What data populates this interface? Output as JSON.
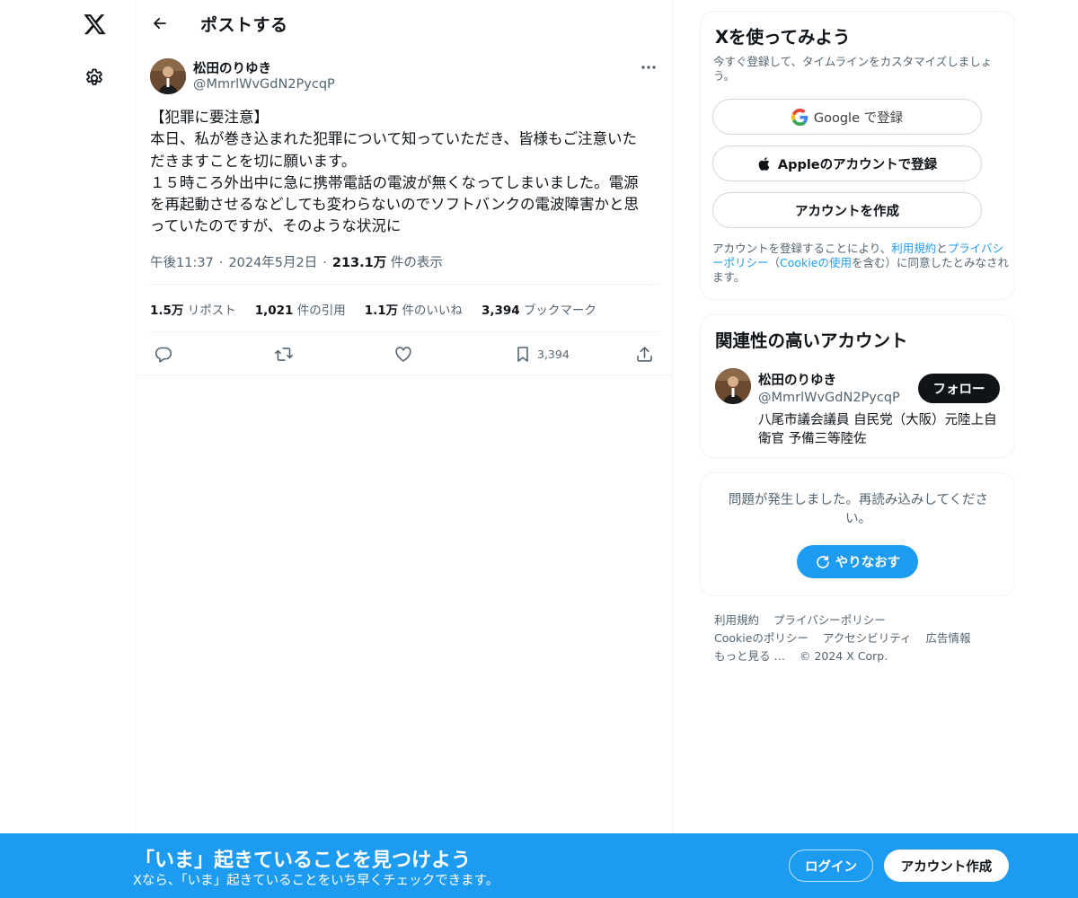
{
  "header": {
    "title": "ポストする"
  },
  "tweet": {
    "author": {
      "name": "松田のりゆき",
      "handle": "@MmrlWvGdN2PycqP"
    },
    "text_lines": [
      "【犯罪に要注意】",
      "本日、私が巻き込まれた犯罪について知っていただき、皆様もご注意いた",
      "だきますことを切に願います。",
      "１５時ころ外出中に急に携帯電話の電波が無くなってしまいました。電源",
      "を再起動させるなどしても変わらないのでソフトバンクの電波障害かと思",
      "っていたのですが、そのような状況に"
    ],
    "time": "午後11:37",
    "date": "2024年5月2日",
    "views_count": "213.1万",
    "views_label": "件の表示",
    "stats": {
      "reposts": {
        "value": "1.5万",
        "label": "リポスト"
      },
      "quotes": {
        "value": "1,021",
        "label": "件の引用"
      },
      "likes": {
        "value": "1.1万",
        "label": "件のいいね"
      },
      "bookmarks": {
        "value": "3,394",
        "label": "ブックマーク"
      }
    },
    "actions": {
      "bookmark_count": "3,394"
    }
  },
  "signup": {
    "title": "Xを使ってみよう",
    "subtitle": "今すぐ登録して、タイムラインをカスタマイズしましょう。",
    "google_label": "Google で登録",
    "apple_label": "Appleのアカウントで登録",
    "create_label": "アカウントを作成",
    "legal": {
      "prefix": "アカウントを登録することにより、",
      "terms": "利用規約",
      "and": "と",
      "privacy": "プライバシーポリシー",
      "paren_open": "（",
      "cookie": "Cookieの使用",
      "suffix": "を含む）に同意したとみなされます。"
    }
  },
  "related": {
    "title": "関連性の高いアカウント",
    "name": "松田のりゆき",
    "handle": "@MmrlWvGdN2PycqP",
    "follow_label": "フォロー",
    "bio": "八尾市議会議員 自民党（大阪）元陸上自衛官 予備三等陸佐"
  },
  "error_card": {
    "message": "問題が発生しました。再読み込みしてください。",
    "retry_label": "やりなおす"
  },
  "footer": {
    "links": [
      "利用規約",
      "プライバシーポリシー",
      "Cookieのポリシー",
      "アクセシビリティ",
      "広告情報",
      "もっと見る …",
      "© 2024 X Corp."
    ]
  },
  "bottom_bar": {
    "headline": "「いま」起きていることを見つけよう",
    "subtext": "Xなら、「いま」起きていることをいち早くチェックできます。",
    "login_label": "ログイン",
    "signup_label": "アカウント作成"
  },
  "colors": {
    "accent": "#1d9bf0",
    "text_primary": "#0f1419",
    "text_secondary": "#536471",
    "border": "#eff3f4"
  },
  "icons": {
    "logo": "x-logo-icon",
    "settings": "gear-icon",
    "back": "arrow-left-icon",
    "more": "more-horizontal-icon",
    "reply": "reply-icon",
    "repost": "repost-icon",
    "like": "heart-icon",
    "bookmark": "bookmark-icon",
    "share": "share-icon",
    "google": "google-icon",
    "apple": "apple-icon",
    "retry": "refresh-icon"
  }
}
